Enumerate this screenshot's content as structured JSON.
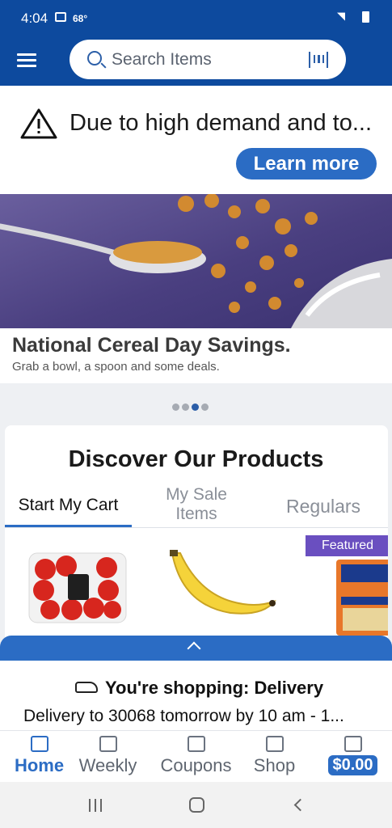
{
  "status_bar": {
    "time": "4:04",
    "temperature": "68°"
  },
  "search": {
    "placeholder": "Search Items"
  },
  "alert": {
    "message": "Due to high demand and to...",
    "button": "Learn more"
  },
  "promo": {
    "headline": "National Cereal Day Savings.",
    "subtext": "Grab a bowl, a spoon and some deals.",
    "carousel_index": 3,
    "carousel_count": 4
  },
  "discover": {
    "title": "Discover Our Products",
    "tabs": [
      {
        "label": "Start My Cart",
        "active": true
      },
      {
        "label": "My Sale Items",
        "active": false
      },
      {
        "label": "Regulars",
        "active": false
      }
    ],
    "badge": "Featured",
    "products": [
      {
        "name": "Campari tomatoes",
        "icon": "tomatoes-icon"
      },
      {
        "name": "Banana",
        "icon": "banana-icon"
      },
      {
        "name": "Uncle Ben's Ready Rice",
        "icon": "rice-pouch-icon"
      }
    ]
  },
  "shopping": {
    "mode": "You're shopping: Delivery",
    "details": "Delivery to 30068 tomorrow by 10 am - 1..."
  },
  "nav": {
    "items": [
      {
        "label": "Home",
        "icon": "home-icon",
        "active": true
      },
      {
        "label": "Weekly",
        "icon": "weekly-ad-icon",
        "active": false
      },
      {
        "label": "Coupons",
        "icon": "coupon-icon",
        "active": false
      },
      {
        "label": "Shop",
        "icon": "shop-icon",
        "active": false
      },
      {
        "label": "$0.00",
        "icon": "cart-icon",
        "active": false
      }
    ]
  },
  "colors": {
    "brand_blue": "#0d4a9e",
    "accent_blue": "#2b6cc4",
    "featured_purple": "#6a4fc0"
  }
}
